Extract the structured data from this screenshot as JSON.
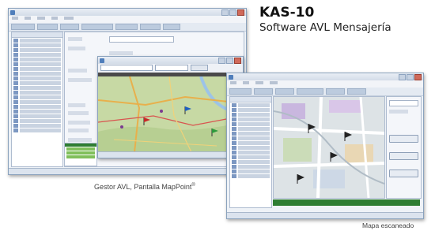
{
  "heading": {
    "product": "KAS-10",
    "subtitle": "Software AVL Mensajería"
  },
  "captions": {
    "left": "Gestor AVL, Pantalla MapPoint",
    "left_mark": "®",
    "right": "Mapa escaneado"
  },
  "colors": {
    "window_border": "#8aa2bd",
    "title_bar": "#d3dce8",
    "map_land": "#c7d9a4",
    "map_road": "#e8b04c",
    "map_water": "#9cc3e8",
    "scanned_map": "#dde3e6"
  },
  "icons": {
    "markers": "flag-icon",
    "window_controls": "minimize-maximize-close-icons"
  }
}
